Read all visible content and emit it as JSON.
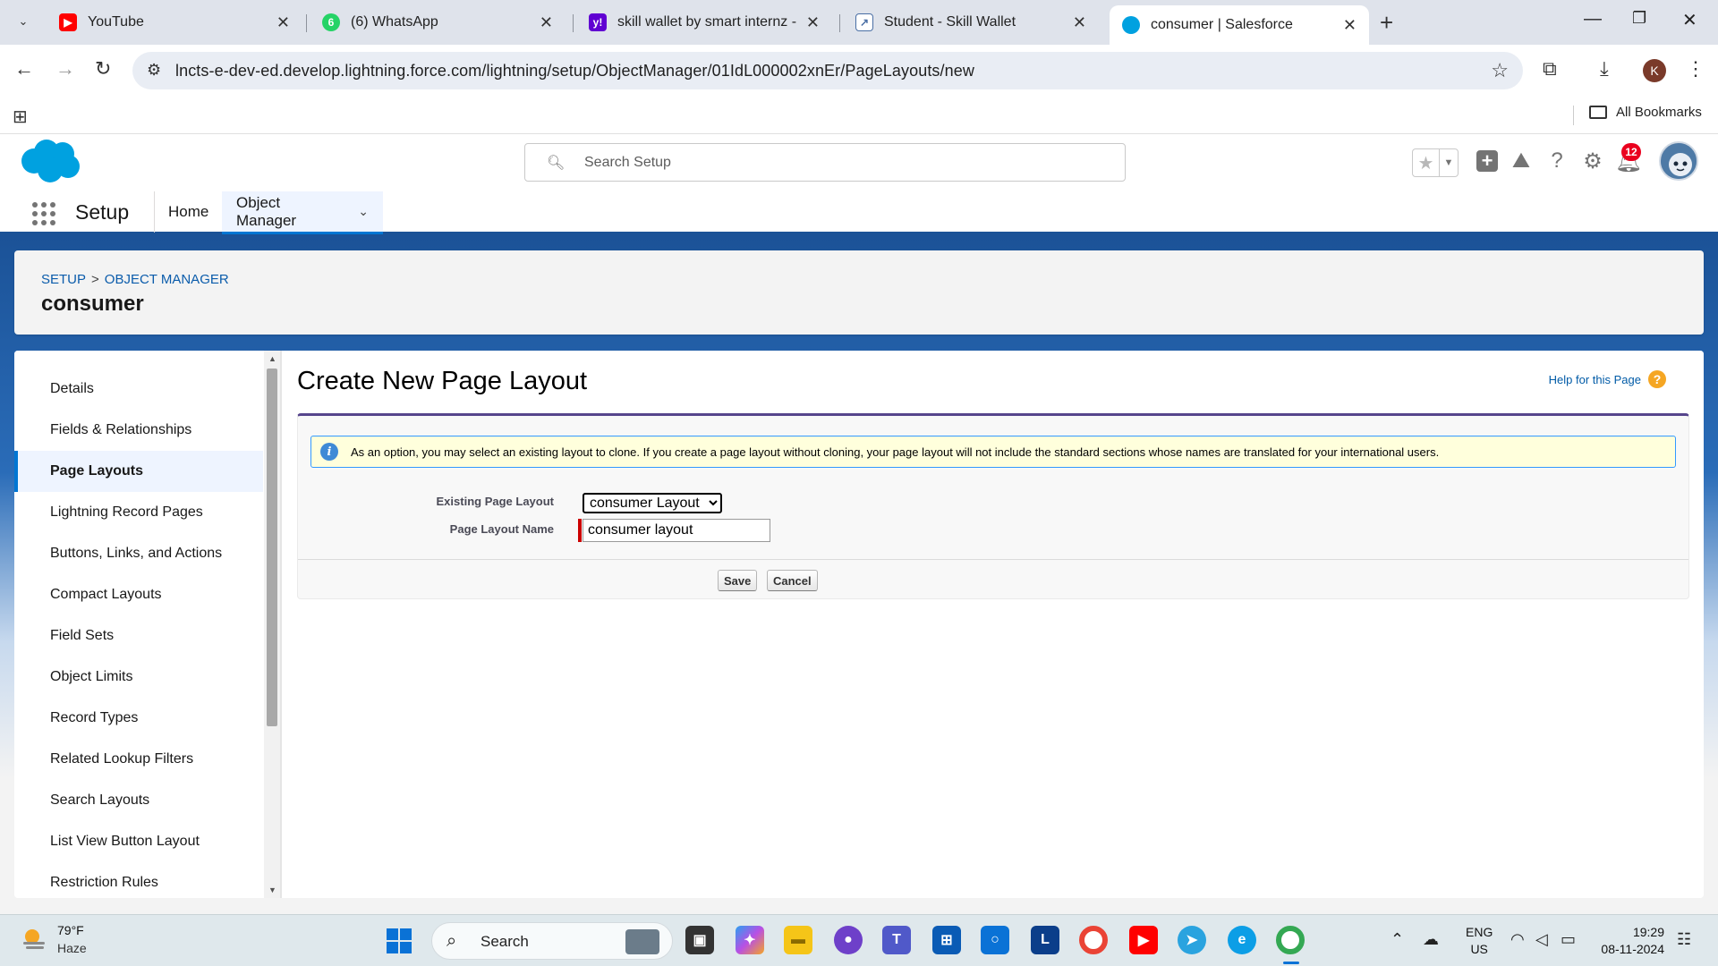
{
  "browser": {
    "tabs": [
      {
        "title": "YouTube",
        "icon": "youtube-icon",
        "color": "#ff0000"
      },
      {
        "title": "(6) WhatsApp",
        "icon": "whatsapp-icon",
        "color": "#25d366"
      },
      {
        "title": "skill wallet by smart internz - Ya",
        "icon": "yahoo-icon",
        "color": "#6001d2"
      },
      {
        "title": "Student - Skill Wallet",
        "icon": "chart-icon",
        "color": "#4a6fa5"
      },
      {
        "title": "consumer | Salesforce",
        "icon": "salesforce-cloud-icon",
        "color": "#00a1e0"
      }
    ],
    "url": "lncts-e-dev-ed.develop.lightning.force.com/lightning/setup/ObjectManager/01IdL000002xnEr/PageLayouts/new",
    "profile_initial": "K",
    "bookmarks_label": "All Bookmarks"
  },
  "sf_header": {
    "search_placeholder": "Search Setup",
    "notification_count": "12",
    "brand_color": "#00a1e0"
  },
  "setup_nav": {
    "app_name": "Setup",
    "items": [
      {
        "label": "Home"
      },
      {
        "label": "Object Manager"
      }
    ]
  },
  "object_header": {
    "breadcrumb_setup": "SETUP",
    "breadcrumb_separator": ">",
    "breadcrumb_object_manager": "OBJECT MANAGER",
    "title": "consumer"
  },
  "sidebar": {
    "items": [
      {
        "label": "Details"
      },
      {
        "label": "Fields & Relationships"
      },
      {
        "label": "Page Layouts"
      },
      {
        "label": "Lightning Record Pages"
      },
      {
        "label": "Buttons, Links, and Actions"
      },
      {
        "label": "Compact Layouts"
      },
      {
        "label": "Field Sets"
      },
      {
        "label": "Object Limits"
      },
      {
        "label": "Record Types"
      },
      {
        "label": "Related Lookup Filters"
      },
      {
        "label": "Search Layouts"
      },
      {
        "label": "List View Button Layout"
      },
      {
        "label": "Restriction Rules"
      }
    ],
    "active_index": 2
  },
  "main": {
    "title": "Create New Page Layout",
    "help_link": "Help for this Page",
    "info_message": "As an option, you may select an existing layout to clone. If you create a page layout without cloning, your page layout will not include the standard sections whose names are translated for your international users.",
    "existing_layout_label": "Existing Page Layout",
    "existing_layout_value": "consumer Layout",
    "layout_name_label": "Page Layout Name",
    "layout_name_value": "consumer layout",
    "save_label": "Save",
    "cancel_label": "Cancel"
  },
  "taskbar": {
    "temperature": "79°F",
    "weather": "Haze",
    "search_label": "Search",
    "lang_line1": "ENG",
    "lang_line2": "US",
    "time": "19:29",
    "date": "08-11-2024"
  }
}
